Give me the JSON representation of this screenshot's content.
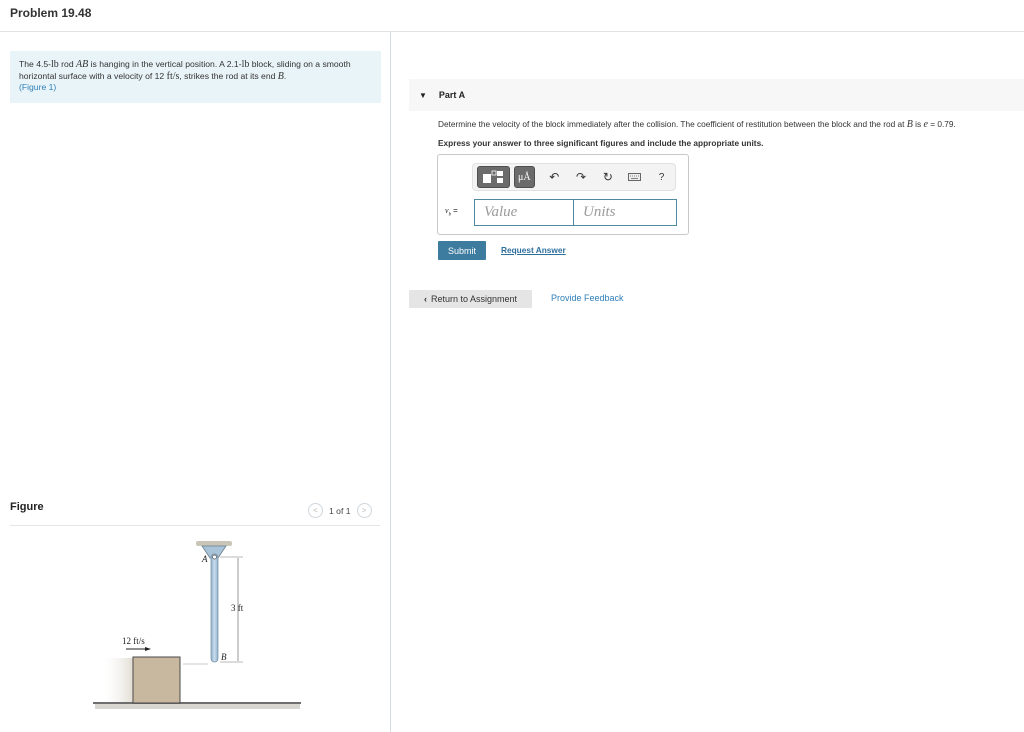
{
  "page": {
    "title": "Problem 19.48"
  },
  "problem": {
    "text_1": "The 4.5-",
    "unit_lb_1": "lb",
    "text_2": " rod ",
    "rod_symbol": "AB",
    "text_3": " is hanging in the vertical position. A 2.1-",
    "unit_lb_2": "lb",
    "text_4": " block, sliding on a smooth horizontal surface with a velocity of 12 ",
    "unit_velocity": "ft/s",
    "text_5": ", strikes the rod at its end ",
    "end_symbol": "B",
    "text_6": ".",
    "figure_link": "(Figure 1)"
  },
  "figure": {
    "header": "Figure",
    "counter": "1 of 1",
    "prev_icon": "chevron-left-icon",
    "next_icon": "chevron-right-icon",
    "labels": {
      "point_a": "A",
      "point_b": "B",
      "length": "3 ft",
      "velocity": "12 ft/s"
    }
  },
  "part": {
    "caret_icon": "triangle-down-icon",
    "title": "Part A",
    "question_text": "Determine the velocity of the block immediately after the collision. The coefficient of restitution between the block and the rod at ",
    "question_symbol": "B",
    "question_mid": " is ",
    "question_e": "e",
    "question_end": " = 0.79.",
    "instruction": "Express your answer to three significant figures and include the appropriate units."
  },
  "answer": {
    "toolbar": {
      "templates_icon": "templates-icon",
      "units_label": "μÅ",
      "undo_icon": "undo-icon",
      "redo_icon": "redo-icon",
      "reset_icon": "reset-icon",
      "keyboard_icon": "keyboard-icon",
      "help_label": "?"
    },
    "variable": "v",
    "variable_sub": "b",
    "equals": "=",
    "value_placeholder": "Value",
    "units_placeholder": "Units"
  },
  "actions": {
    "submit": "Submit",
    "request_answer": "Request Answer",
    "return_to_assignment": "Return to Assignment",
    "return_icon": "chevron-left-icon",
    "provide_feedback": "Provide Feedback"
  }
}
